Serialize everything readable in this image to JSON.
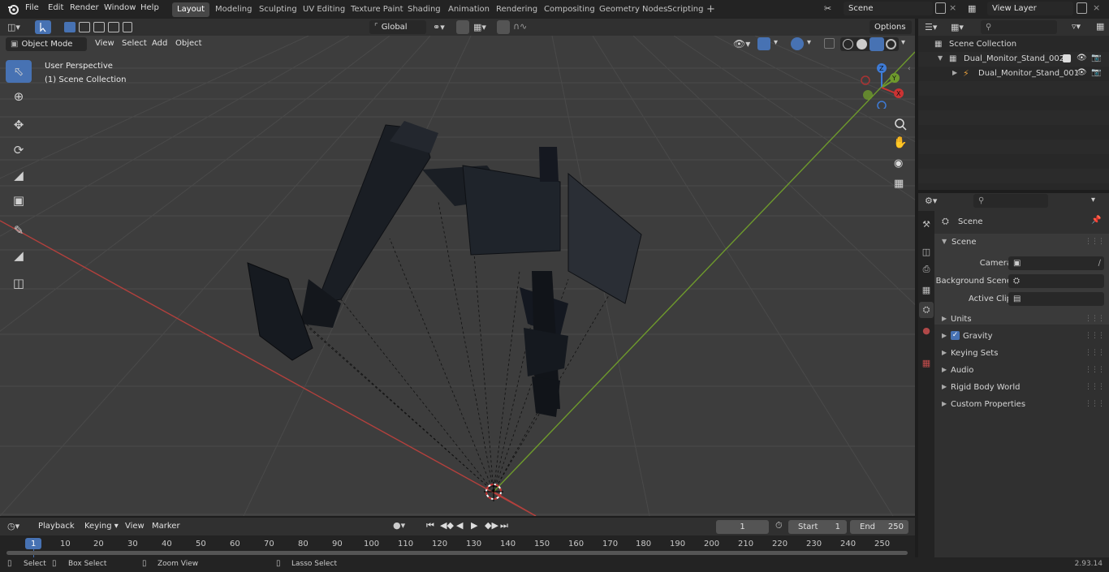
{
  "topbar": {
    "menus": [
      "File",
      "Edit",
      "Render",
      "Window",
      "Help"
    ],
    "workspaces": [
      "Layout",
      "Modeling",
      "Sculpting",
      "UV Editing",
      "Texture Paint",
      "Shading",
      "Animation",
      "Rendering",
      "Compositing",
      "Geometry Nodes",
      "Scripting"
    ],
    "active_workspace": "Layout",
    "scene": "Scene",
    "view_layer": "View Layer"
  },
  "viewport_header": {
    "mode": "Object Mode",
    "menus": [
      "View",
      "Select",
      "Add",
      "Object"
    ],
    "transform_orientation": "Global",
    "options": "Options"
  },
  "viewport": {
    "perspective": "User Perspective",
    "collection": "(1) Scene Collection",
    "gizmo_axes": {
      "x": "X",
      "y": "Y",
      "z": "Z"
    },
    "colors": {
      "bg": "#3d3d3d",
      "x_axis": "#c2413f",
      "y_axis": "#6e9a2c",
      "accent": "#4772b3"
    }
  },
  "tools": [
    "select-box-icon",
    "cursor-icon",
    "move-icon",
    "rotate-icon",
    "scale-icon",
    "transform-icon",
    "annotate-icon",
    "measure-icon",
    "add-cube-icon"
  ],
  "outliner": {
    "root": "Scene Collection",
    "items": [
      {
        "name": "Dual_Monitor_Stand_002"
      },
      {
        "name": "Dual_Monitor_Stand_001"
      }
    ]
  },
  "properties": {
    "title": "Scene",
    "section": "Scene",
    "fields": [
      {
        "label": "Camera"
      },
      {
        "label": "Background Scene"
      },
      {
        "label": "Active Clip"
      }
    ],
    "panels": [
      "Units",
      "Gravity",
      "Keying Sets",
      "Audio",
      "Rigid Body World",
      "Custom Properties"
    ]
  },
  "timeline": {
    "menus": [
      "Playback",
      "Keying",
      "View",
      "Marker"
    ],
    "current_frame": "1",
    "start_label": "Start",
    "start": "1",
    "end_label": "End",
    "end": "250",
    "ruler": [
      "1",
      "10",
      "20",
      "30",
      "40",
      "50",
      "60",
      "70",
      "80",
      "90",
      "100",
      "110",
      "120",
      "130",
      "140",
      "150",
      "160",
      "170",
      "180",
      "190",
      "200",
      "210",
      "220",
      "230",
      "240",
      "250"
    ]
  },
  "statusbar": {
    "select": "Select",
    "box_select": "Box Select",
    "zoom_view": "Zoom View",
    "lasso_select": "Lasso Select",
    "version": "2.93.14"
  }
}
